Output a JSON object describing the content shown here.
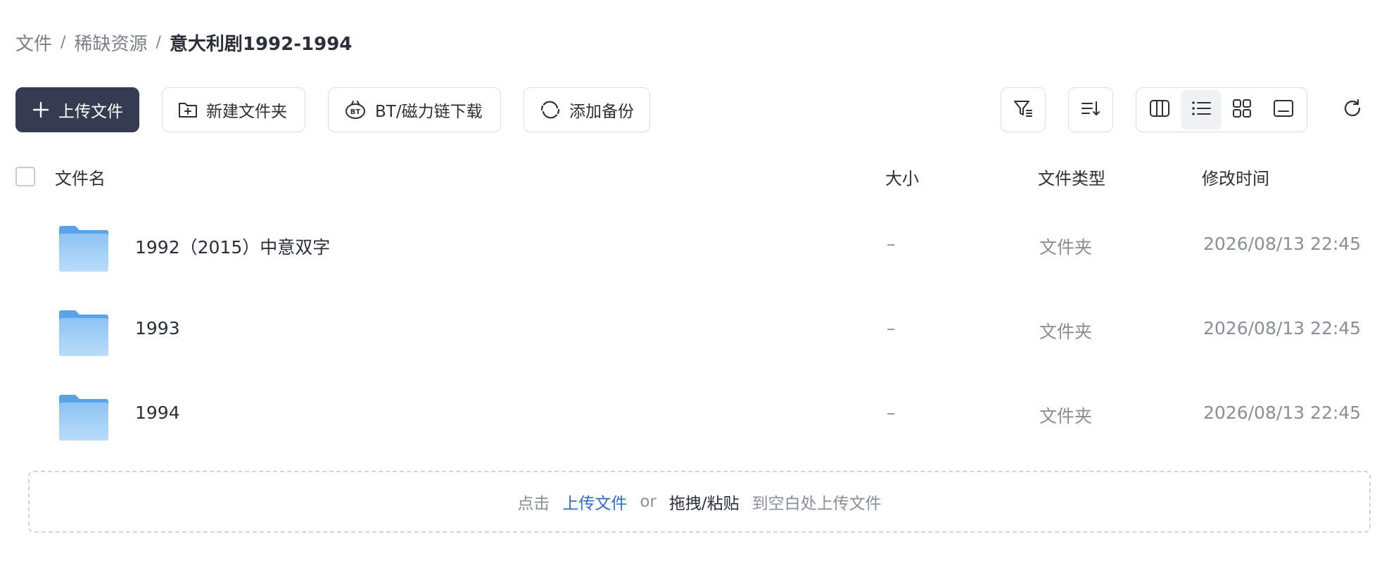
{
  "breadcrumb": {
    "items": [
      "文件",
      "稀缺资源"
    ],
    "current": "意大利剧1992-1994",
    "separator": "/"
  },
  "toolbar": {
    "upload_label": "上传文件",
    "new_folder_label": "新建文件夹",
    "bt_download_label": "BT/磁力链下载",
    "add_backup_label": "添加备份",
    "icons": {
      "upload": "plus-icon",
      "new_folder": "folder-plus-icon",
      "bt": "bt-icon",
      "backup": "sync-icon",
      "filter": "filter-icon",
      "sort": "sort-icon",
      "refresh": "refresh-icon"
    },
    "view_modes": [
      "columns-view",
      "list-view",
      "grid-view",
      "preview-view"
    ],
    "active_view": "list-view"
  },
  "table": {
    "columns": {
      "name": "文件名",
      "size": "大小",
      "type": "文件类型",
      "modified": "修改时间"
    },
    "rows": [
      {
        "name": "1992（2015）中意双字",
        "size": "–",
        "type": "文件夹",
        "modified": "2026/08/13 22:45"
      },
      {
        "name": "1993",
        "size": "–",
        "type": "文件夹",
        "modified": "2026/08/13 22:45"
      },
      {
        "name": "1994",
        "size": "–",
        "type": "文件夹",
        "modified": "2026/08/13 22:45"
      }
    ]
  },
  "dropzone": {
    "prefix": "点击",
    "upload_link": "上传文件",
    "or": "or",
    "drag_paste": "拖拽/粘贴",
    "suffix": "到空白处上传文件"
  },
  "colors": {
    "primary": "#363b52",
    "link": "#2f6bdc",
    "folder": "#7fb8f0"
  }
}
